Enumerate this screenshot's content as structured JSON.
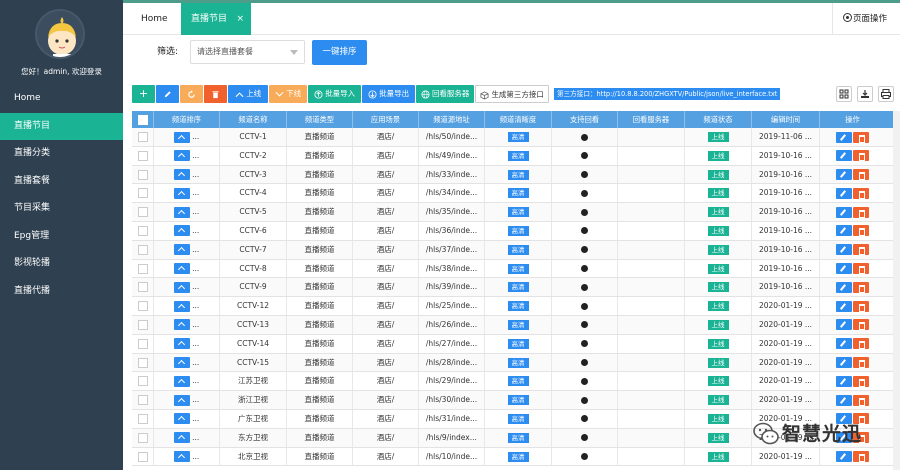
{
  "sidebar": {
    "greeting": "您好！admin, 欢迎登录",
    "items": [
      {
        "label": "Home",
        "active": false
      },
      {
        "label": "直播节目",
        "active": true
      },
      {
        "label": "直播分类",
        "active": false
      },
      {
        "label": "直播套餐",
        "active": false
      },
      {
        "label": "节目采集",
        "active": false
      },
      {
        "label": "Epg管理",
        "active": false
      },
      {
        "label": "影视轮播",
        "active": false
      },
      {
        "label": "直播代播",
        "active": false
      }
    ]
  },
  "tabs": {
    "home": "Home",
    "active": "直播节目",
    "close": "×",
    "page_ops": "页面操作"
  },
  "filter": {
    "label": "筛选:",
    "placeholder": "请选择直播套餐",
    "sort_button": "一键排序"
  },
  "toolbar": {
    "add": "+",
    "online": "上线",
    "offline": "下线",
    "batch_import": "批量导入",
    "batch_export": "批量导出",
    "replay_server": "回看服务器",
    "generate_api": "生成第三方接口",
    "api_url": "第三方接口：http://10.8.8.200/ZHGXTV/Public/json/live_interface.txt"
  },
  "table": {
    "headers": [
      "频道排序",
      "频道名称",
      "频道类型",
      "应用场景",
      "频道源地址",
      "频道清晰度",
      "支持回看",
      "回看服务器",
      "频道状态",
      "编辑时间",
      "操作"
    ],
    "rows": [
      {
        "name": "CCTV-1",
        "type": "直播频道",
        "scene": "酒店/",
        "src": "/hls/50/inde...",
        "quality": "高清",
        "status": "上线",
        "time": "2019-11-06 ..."
      },
      {
        "name": "CCTV-2",
        "type": "直播频道",
        "scene": "酒店/",
        "src": "/hls/49/inde...",
        "quality": "高清",
        "status": "上线",
        "time": "2019-10-16 ..."
      },
      {
        "name": "CCTV-3",
        "type": "直播频道",
        "scene": "酒店/",
        "src": "/hls/33/inde...",
        "quality": "高清",
        "status": "上线",
        "time": "2019-10-16 ..."
      },
      {
        "name": "CCTV-4",
        "type": "直播频道",
        "scene": "酒店/",
        "src": "/hls/34/inde...",
        "quality": "高清",
        "status": "上线",
        "time": "2019-10-16 ..."
      },
      {
        "name": "CCTV-5",
        "type": "直播频道",
        "scene": "酒店/",
        "src": "/hls/35/inde...",
        "quality": "高清",
        "status": "上线",
        "time": "2019-10-16 ..."
      },
      {
        "name": "CCTV-6",
        "type": "直播频道",
        "scene": "酒店/",
        "src": "/hls/36/inde...",
        "quality": "高清",
        "status": "上线",
        "time": "2019-10-16 ..."
      },
      {
        "name": "CCTV-7",
        "type": "直播频道",
        "scene": "酒店/",
        "src": "/hls/37/inde...",
        "quality": "高清",
        "status": "上线",
        "time": "2019-10-16 ..."
      },
      {
        "name": "CCTV-8",
        "type": "直播频道",
        "scene": "酒店/",
        "src": "/hls/38/inde...",
        "quality": "高清",
        "status": "上线",
        "time": "2019-10-16 ..."
      },
      {
        "name": "CCTV-9",
        "type": "直播频道",
        "scene": "酒店/",
        "src": "/hls/39/inde...",
        "quality": "高清",
        "status": "上线",
        "time": "2019-10-16 ..."
      },
      {
        "name": "CCTV-12",
        "type": "直播频道",
        "scene": "酒店/",
        "src": "/hls/25/inde...",
        "quality": "高清",
        "status": "上线",
        "time": "2020-01-19 ..."
      },
      {
        "name": "CCTV-13",
        "type": "直播频道",
        "scene": "酒店/",
        "src": "/hls/26/inde...",
        "quality": "高清",
        "status": "上线",
        "time": "2020-01-19 ..."
      },
      {
        "name": "CCTV-14",
        "type": "直播频道",
        "scene": "酒店/",
        "src": "/hls/27/inde...",
        "quality": "高清",
        "status": "上线",
        "time": "2020-01-19 ..."
      },
      {
        "name": "CCTV-15",
        "type": "直播频道",
        "scene": "酒店/",
        "src": "/hls/28/inde...",
        "quality": "高清",
        "status": "上线",
        "time": "2020-01-19 ..."
      },
      {
        "name": "江苏卫视",
        "type": "直播频道",
        "scene": "酒店/",
        "src": "/hls/29/inde...",
        "quality": "高清",
        "status": "上线",
        "time": "2020-01-19 ..."
      },
      {
        "name": "浙江卫视",
        "type": "直播频道",
        "scene": "酒店/",
        "src": "/hls/30/inde...",
        "quality": "高清",
        "status": "上线",
        "time": "2020-01-19 ..."
      },
      {
        "name": "广东卫视",
        "type": "直播频道",
        "scene": "酒店/",
        "src": "/hls/31/inde...",
        "quality": "高清",
        "status": "上线",
        "time": "2020-01-19 ..."
      },
      {
        "name": "东方卫视",
        "type": "直播频道",
        "scene": "酒店/",
        "src": "/hls/9/index...",
        "quality": "高清",
        "status": "上线",
        "time": "2020-01-19 ..."
      },
      {
        "name": "北京卫视",
        "type": "直播频道",
        "scene": "酒店/",
        "src": "/hls/10/inde...",
        "quality": "高清",
        "status": "上线",
        "time": "2020-01-19 ..."
      }
    ]
  },
  "watermark": "智慧光迅",
  "colors": {
    "sidebar": "#2f4050",
    "accent": "#1ab394",
    "primary": "#2d8cf0",
    "danger": "#f0612e",
    "warning": "#f8ac59"
  }
}
